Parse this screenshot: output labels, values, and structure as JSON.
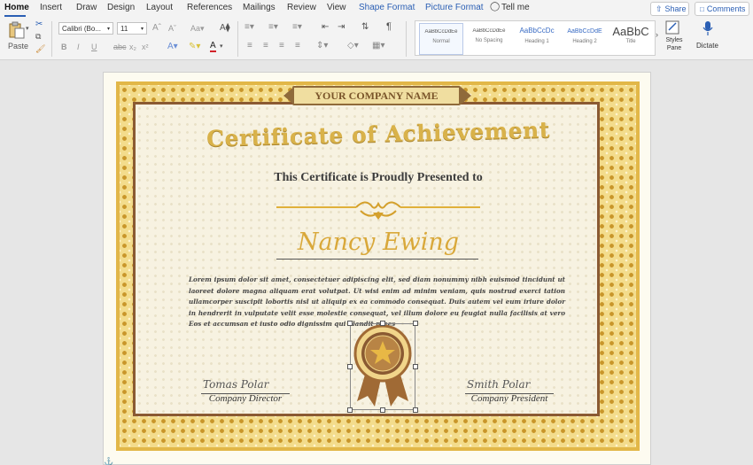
{
  "tabs": [
    {
      "label": "Home"
    },
    {
      "label": "Insert"
    },
    {
      "label": "Draw"
    },
    {
      "label": "Design"
    },
    {
      "label": "Layout"
    },
    {
      "label": "References"
    },
    {
      "label": "Mailings"
    },
    {
      "label": "Review"
    },
    {
      "label": "View"
    },
    {
      "label": "Shape Format"
    },
    {
      "label": "Picture Format"
    }
  ],
  "tell_me": "Tell me",
  "share_label": "Share",
  "comments_label": "Comments",
  "ribbon": {
    "paste_label": "Paste",
    "font_name": "Calibri (Bo...",
    "font_size": "11",
    "styles": [
      {
        "sample": "AaBbCcDdEe",
        "name": "Normal"
      },
      {
        "sample": "AaBbCcDdEe",
        "name": "No Spacing"
      },
      {
        "sample": "AaBbCcDc",
        "name": "Heading 1"
      },
      {
        "sample": "AaBbCcDdE",
        "name": "Heading 2"
      },
      {
        "sample": "AaBbC",
        "name": "Title"
      }
    ],
    "styles_pane_label": "Styles Pane",
    "dictate_label": "Dictate"
  },
  "certificate": {
    "company_banner": "YOUR COMPANY NAME",
    "title": "Certificate of Achievement",
    "subtitle": "This Certificate is Proudly Presented to",
    "recipient": "Nancy Ewing",
    "body": "Lorem ipsum dolor sit amet, consectetuer adipiscing elit, sed diam nonummy nibh euismod tincidunt ut laoreet dolore magna aliquam erat volutpat. Ut wisi enim ad minim veniam, quis nostrud exerci tation ullamcorper suscipit lobortis nisl ut aliquip ex ea commodo consequat. Duis autem vel eum iriure dolor in hendrerit in vulputate velit esse molestie consequat, vel illum dolore eu feugiat nulla facilisis at vero Eos et accumsan et iusto odio dignissim qui blandit praes",
    "signer_left": {
      "signature": "Tomas Polar",
      "title": "Company Director"
    },
    "signer_right": {
      "signature": "Smith Polar",
      "title": "Company President"
    }
  },
  "colors": {
    "accent_blue": "#2b5fb4",
    "gold": "#e2b748",
    "brown": "#8a5a32",
    "font_color_red": "#d2232a"
  }
}
